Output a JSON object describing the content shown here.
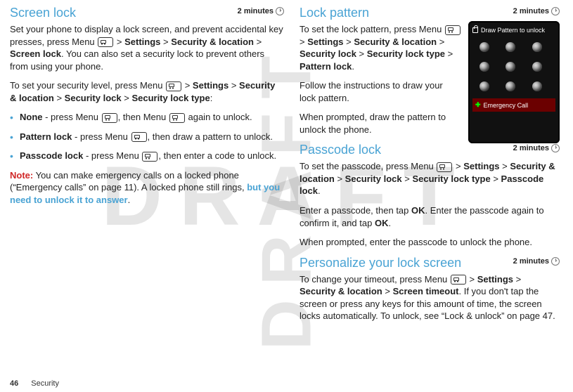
{
  "watermark": "DRAFT",
  "time_badge": "2 minutes",
  "footer": {
    "page_num": "46",
    "section": "Security"
  },
  "left": {
    "title": "Screen lock",
    "p1_a": "Set your phone to display a lock screen, and prevent accidental key presses, press Menu ",
    "p1_b": " > ",
    "p1_settings": "Settings",
    "p1_c": " > ",
    "p1_secloc": "Security & location",
    "p1_d": " > ",
    "p1_screenlock": "Screen lock",
    "p1_e": ". You can also set a security lock to prevent others from using your phone.",
    "p2_a": "To set your security level, press Menu ",
    "p2_b": " > ",
    "p2_settings": "Settings",
    "p2_c": " > ",
    "p2_secloc": "Security & location",
    "p2_d": " > ",
    "p2_seclock": "Security lock",
    "p2_e": " > ",
    "p2_type": "Security lock type",
    "p2_f": ":",
    "li1_b": "None",
    "li1_a": " - press Menu ",
    "li1_mid": ", then Menu ",
    "li1_end": " again to unlock.",
    "li2_b": "Pattern lock",
    "li2_a": " - press Menu ",
    "li2_end": ", then draw a pattern to unlock.",
    "li3_b": "Passcode lock",
    "li3_a": " - press Menu ",
    "li3_end": ", then enter a code to unlock.",
    "note_label": "Note:",
    "note_a": " You can make emergency calls on a locked phone (“Emergency calls” on page 11). A locked phone still rings, ",
    "note_link": "but you need to unlock it to answer",
    "note_b": "."
  },
  "right": {
    "s1": {
      "title": "Lock pattern",
      "p1_a": "To set the lock pattern, press Menu ",
      "p1_b": " > ",
      "p1_settings": "Settings",
      "p1_c": " > ",
      "p1_secloc": "Security & location",
      "p1_d": " > ",
      "p1_seclock": "Security lock",
      "p1_e": " > ",
      "p1_type": "Security lock type",
      "p1_f": " > ",
      "p1_pattern": "Pattern lock",
      "p1_g": ".",
      "p2": "Follow the instructions to draw your lock pattern.",
      "p3": "When prompted, draw the pattern to unlock the phone.",
      "phone_title": "Draw Pattern to unlock",
      "phone_emg": "Emergency Call"
    },
    "s2": {
      "title": "Passcode lock",
      "p1_a": "To set the passcode, press Menu ",
      "p1_b": " > ",
      "p1_settings": "Settings",
      "p1_c": " > ",
      "p1_secloc": "Security & location",
      "p1_d": " > ",
      "p1_seclock": "Security lock",
      "p1_e": " > ",
      "p1_type": "Security lock type",
      "p1_f": " > ",
      "p1_pass": "Passcode lock",
      "p1_g": ".",
      "p2_a": "Enter a passcode, then tap ",
      "p2_ok1": "OK",
      "p2_b": ". Enter the passcode again to confirm it, and tap ",
      "p2_ok2": "OK",
      "p2_c": ".",
      "p3": "When prompted, enter the passcode to unlock the phone."
    },
    "s3": {
      "title": "Personalize your lock screen",
      "p1_a": "To change your timeout, press Menu ",
      "p1_b": " > ",
      "p1_settings": "Settings",
      "p1_c": " > ",
      "p1_secloc": "Security & location",
      "p1_d": " > ",
      "p1_timeout": "Screen timeout",
      "p1_e": ". If you don't tap the screen or press any keys for this amount of time, the screen locks automatically. To unlock, see “Lock & unlock” on page 47."
    }
  }
}
